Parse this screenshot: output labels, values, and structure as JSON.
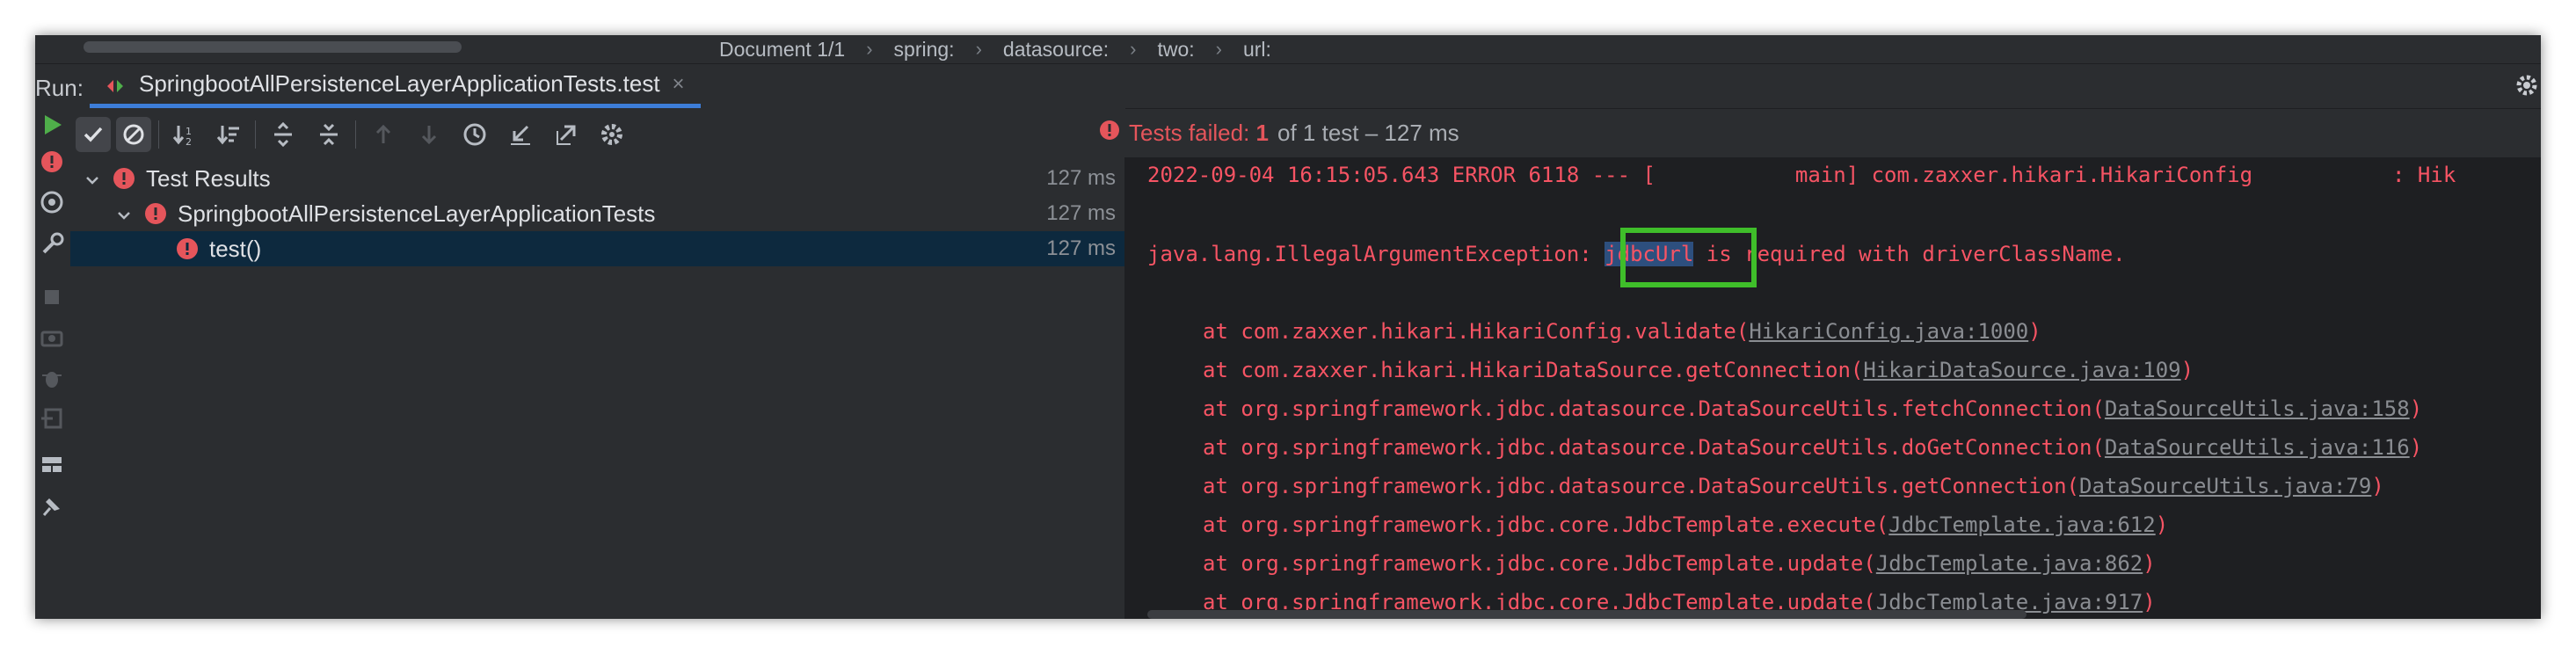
{
  "breadcrumb": {
    "items": [
      "Document 1/1",
      "spring:",
      "datasource:",
      "two:",
      "url:"
    ],
    "separator": "›"
  },
  "run": {
    "label": "Run:",
    "tab_label": "SpringbootAllPersistenceLayerApplicationTests.test",
    "tab_close": "×"
  },
  "status": {
    "prefix": "Tests failed:",
    "failed_count": "1",
    "suffix": "of 1 test – 127 ms"
  },
  "tree": {
    "rows": [
      {
        "label": "Test Results",
        "duration": "127 ms"
      },
      {
        "label": "SpringbootAllPersistenceLayerApplicationTests",
        "duration": "127 ms"
      },
      {
        "label": "test()",
        "duration": "127 ms"
      }
    ]
  },
  "console": {
    "log_line": "2022-09-04 16:15:05.643 ERROR 6118 --- [           main] com.zaxxer.hikari.HikariConfig           : Hik",
    "exception_prefix": "java.lang.IllegalArgumentException: ",
    "exception_highlight": "jdbcUrl",
    "exception_suffix": " is required with driverClassName.",
    "stack": [
      {
        "text": "at com.zaxxer.hikari.HikariConfig.validate(",
        "link": "HikariConfig.java:1000",
        "end": ")"
      },
      {
        "text": "at com.zaxxer.hikari.HikariDataSource.getConnection(",
        "link": "HikariDataSource.java:109",
        "end": ")"
      },
      {
        "text": "at org.springframework.jdbc.datasource.DataSourceUtils.fetchConnection(",
        "link": "DataSourceUtils.java:158",
        "end": ")"
      },
      {
        "text": "at org.springframework.jdbc.datasource.DataSourceUtils.doGetConnection(",
        "link": "DataSourceUtils.java:116",
        "end": ")"
      },
      {
        "text": "at org.springframework.jdbc.datasource.DataSourceUtils.getConnection(",
        "link": "DataSourceUtils.java:79",
        "end": ")"
      },
      {
        "text": "at org.springframework.jdbc.core.JdbcTemplate.execute(",
        "link": "JdbcTemplate.java:612",
        "end": ")"
      },
      {
        "text": "at org.springframework.jdbc.core.JdbcTemplate.update(",
        "link": "JdbcTemplate.java:862",
        "end": ")"
      },
      {
        "text": "at org.springframework.jdbc.core.JdbcTemplate.update(",
        "link": "JdbcTemplate.java:917",
        "end": ")"
      }
    ]
  },
  "colors": {
    "error_red": "#f75464",
    "run_green": "#4fae4a",
    "highlight_box": "#3fbe2a",
    "tab_underline": "#3d7dd8"
  },
  "icons": {
    "toolbar": [
      "show-passed-icon",
      "show-ignored-icon",
      "sort-alpha-icon",
      "sort-duration-icon",
      "expand-all-icon",
      "collapse-all-icon",
      "previous-failed-icon",
      "next-failed-icon",
      "history-icon",
      "import-tests-icon",
      "export-tests-icon",
      "settings-icon"
    ],
    "leftstrip": [
      "rerun-icon",
      "rerun-failed-icon",
      "toggle-autotest-icon",
      "wrench-icon",
      "stop-icon",
      "camera-icon",
      "debug-icon",
      "login-icon",
      "layout-icon",
      "pin-icon"
    ]
  }
}
